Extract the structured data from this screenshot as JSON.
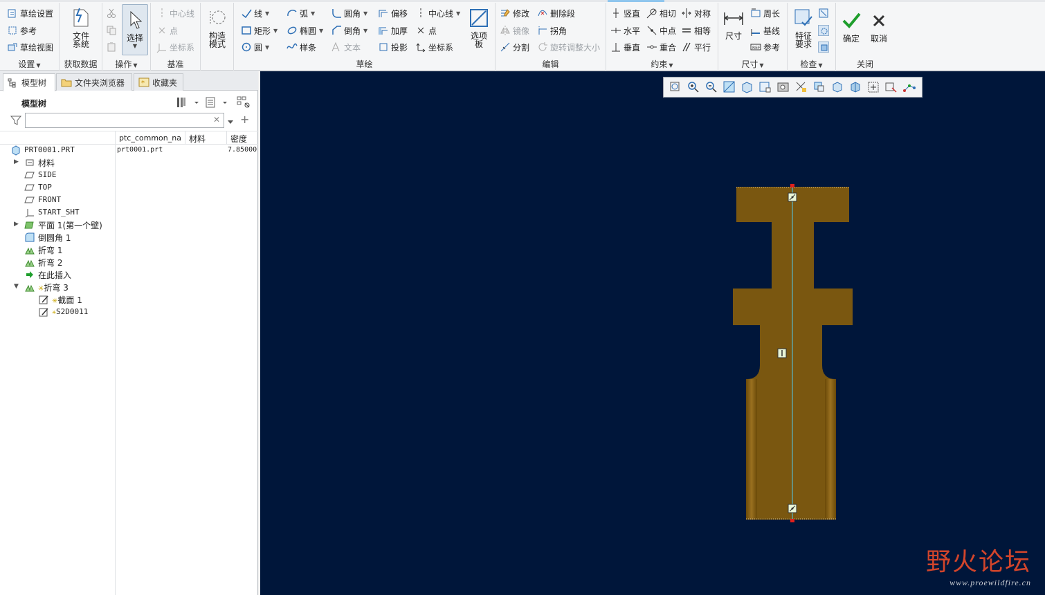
{
  "ribbon": {
    "groups": {
      "settings": {
        "label": "设置",
        "items": [
          "草绘设置",
          "参考",
          "草绘视图"
        ]
      },
      "get_data": {
        "label": "获取数据",
        "file_system": "文件\n系统"
      },
      "operations": {
        "label": "操作",
        "select": "选择"
      },
      "datum": {
        "label": "基准",
        "items": [
          "中心线",
          "点",
          "坐标系"
        ]
      },
      "construction": {
        "label": "构造\n模式"
      },
      "sketch": {
        "label": "草绘",
        "col1": [
          "线",
          "矩形",
          "圆"
        ],
        "col2": [
          "弧",
          "椭圆",
          "样条"
        ],
        "col3": [
          "圆角",
          "倒角",
          "文本"
        ],
        "col4": [
          "偏移",
          "加厚",
          "投影"
        ],
        "col5": [
          "中心线",
          "点",
          "坐标系"
        ],
        "palette": "选项\n板"
      },
      "edit": {
        "label": "编辑",
        "col1": [
          "修改",
          "镜像",
          "分割"
        ],
        "col2": [
          "删除段",
          "拐角",
          "旋转调整大小"
        ]
      },
      "constrain": {
        "label": "约束",
        "col1": [
          "竖直",
          "水平",
          "垂直"
        ],
        "col2": [
          "相切",
          "中点",
          "重合"
        ],
        "col3": [
          "对称",
          "相等",
          "平行"
        ]
      },
      "dimension": {
        "label": "尺寸",
        "big": "尺寸",
        "items": [
          "周长",
          "基线",
          "参考"
        ]
      },
      "inspect": {
        "label": "检查",
        "big": "特征\n要求"
      },
      "close": {
        "label": "关闭",
        "ok": "确定",
        "cancel": "取消"
      }
    }
  },
  "panel": {
    "tabs": [
      "模型树",
      "文件夹浏览器",
      "收藏夹"
    ],
    "tree_title": "模型树",
    "search_placeholder": "",
    "columns": [
      "ptc_common_name",
      "材料",
      "密度"
    ],
    "rows": [
      {
        "label": "PRT0001.PRT",
        "common_name": "prt0001.prt",
        "density": "7.85000"
      },
      {
        "label": "材料"
      },
      {
        "label": "SIDE"
      },
      {
        "label": "TOP"
      },
      {
        "label": "FRONT"
      },
      {
        "label": "START_SHT"
      },
      {
        "label": "平面 1(第一个壁)"
      },
      {
        "label": "倒圆角 1"
      },
      {
        "label": "折弯 1"
      },
      {
        "label": "折弯 2"
      },
      {
        "label": "在此插入"
      },
      {
        "label": "折弯 3"
      },
      {
        "label": "截面 1"
      },
      {
        "label": "S2D0011"
      }
    ]
  },
  "watermark": {
    "title": "野火论坛",
    "url": "www.proewildfire.cn"
  },
  "colors": {
    "graphics_bg": "#00163a",
    "part": "#7a5710",
    "centerline": "#5ab7c8",
    "accent_ok": "#1e9e2c"
  }
}
